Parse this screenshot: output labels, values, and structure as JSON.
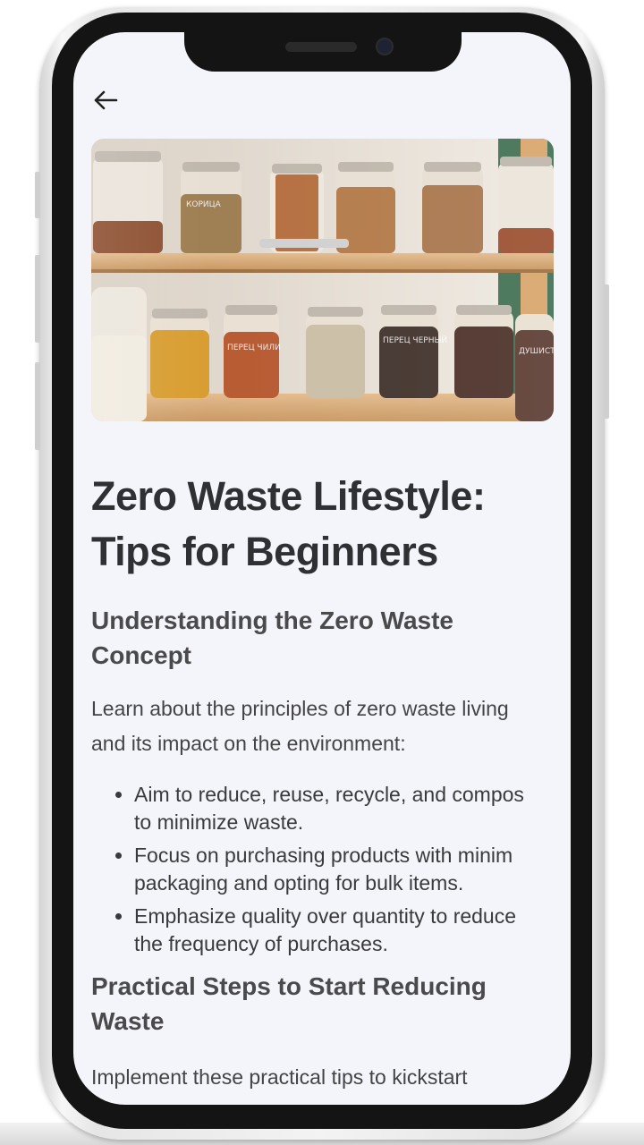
{
  "header": {
    "back_icon": "arrow-left-icon"
  },
  "hero_image": {
    "subject": "glass jars of spices on wooden shelves"
  },
  "article": {
    "title_line1": "Zero Waste Lifestyle:",
    "title_line2": "Tips for Beginners",
    "section1": {
      "heading_line1": "Understanding the Zero Waste",
      "heading_line2": "Concept",
      "intro_line1": "Learn about the principles of zero waste living",
      "intro_line2": "and its impact on the environment:",
      "bullets": [
        {
          "line1": "Aim to reduce, reuse, recycle, and compos",
          "line2": "to minimize waste."
        },
        {
          "line1": "Focus on purchasing products with minim",
          "line2": "packaging and opting for bulk items."
        },
        {
          "line1": "Emphasize quality over quantity to reduce",
          "line2": "the frequency of purchases."
        }
      ]
    },
    "section2": {
      "heading_line1": "Practical Steps to Start Reducing",
      "heading_line2": "Waste",
      "intro_line1": "Implement these practical tips to kickstart"
    }
  },
  "jar_labels": [
    "КОРИЦА",
    "ПЕРЕЦ ЧИЛИ",
    "ПЕРЕЦ ЧЕРНЫЙ",
    "ДУШИСТ"
  ]
}
